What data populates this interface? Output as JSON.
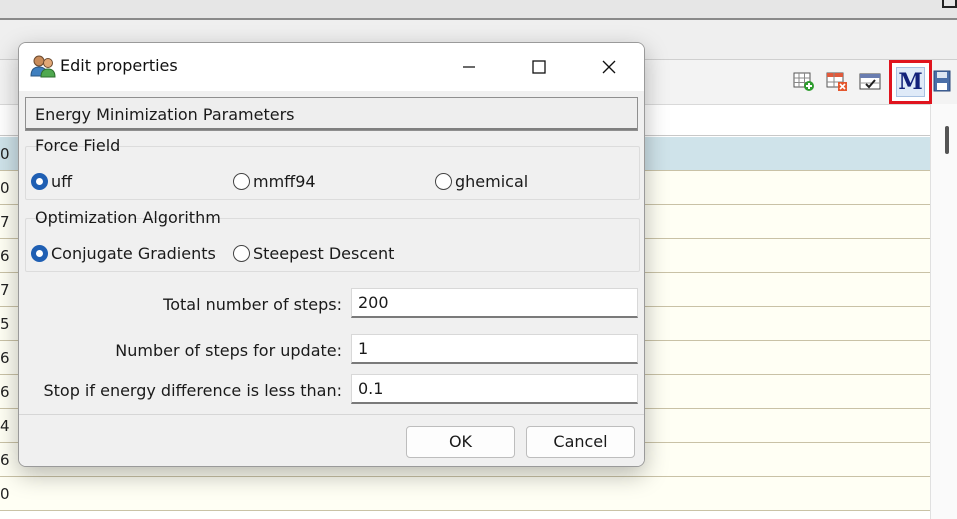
{
  "background_app": {
    "toolbar_icons": [
      "add-row-icon",
      "delete-row-icon",
      "edit-check-icon",
      "minimize-molecule-icon",
      "save-icon"
    ],
    "highlighted_button_label": "M",
    "highlight_color": "#e0141e",
    "row_numbers": [
      "0",
      "0",
      "7",
      "6",
      "7",
      "5",
      "6",
      "6",
      "4",
      "6",
      "0"
    ]
  },
  "dialog": {
    "title": "Edit properties",
    "section_title": "Energy Minimization Parameters",
    "force_field": {
      "label": "Force Field",
      "options": [
        "uff",
        "mmff94",
        "ghemical"
      ],
      "selected": "uff"
    },
    "optimization": {
      "label": "Optimization Algorithm",
      "options": [
        "Conjugate Gradients",
        "Steepest Descent"
      ],
      "selected": "Conjugate Gradients"
    },
    "fields": [
      {
        "label": "Total number of steps:",
        "value": "200"
      },
      {
        "label": "Number of steps for update:",
        "value": "1"
      },
      {
        "label": "Stop if energy difference is less than:",
        "value": "0.1"
      }
    ],
    "buttons": {
      "ok": "OK",
      "cancel": "Cancel"
    },
    "accent_color": "#1f5fb3"
  }
}
